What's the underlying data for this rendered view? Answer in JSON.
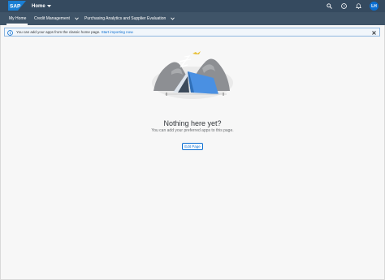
{
  "shell": {
    "logo_text": "SAP",
    "title": "Home",
    "avatar_initials": "LH",
    "icons": [
      "search-icon",
      "help-icon",
      "notifications-icon"
    ]
  },
  "nav": {
    "items": [
      {
        "label": "My Home",
        "has_dropdown": false,
        "active": true
      },
      {
        "label": "Credit Management",
        "has_dropdown": true,
        "active": false
      },
      {
        "label": "Purchasing Analytics and Supplier Evaluation",
        "has_dropdown": true,
        "active": false
      }
    ]
  },
  "info_bar": {
    "message": "You can add your apps from the classic home page.",
    "link_text": "Start importing now."
  },
  "empty_state": {
    "title": "Nothing here yet?",
    "description": "You can add your preferred apps to this page.",
    "button_label": "Edit Page"
  },
  "colors": {
    "shell_bg": "#354a5f",
    "nav_bg": "#3f5468",
    "accent": "#0a6ed1",
    "page_bg": "#f7f7f7"
  }
}
